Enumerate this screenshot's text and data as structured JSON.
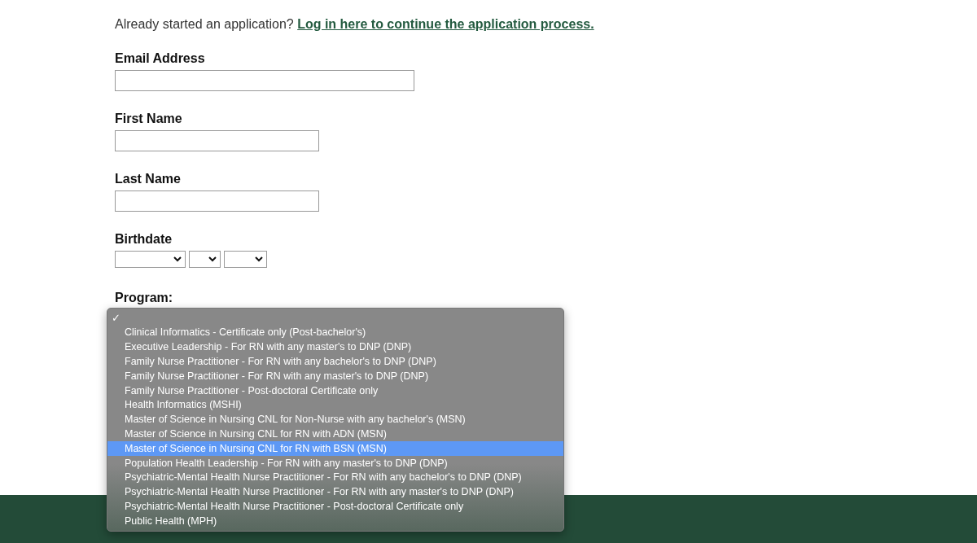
{
  "intro": {
    "text": "Already started an application?",
    "link": "Log in here to continue the application process."
  },
  "fields": [
    {
      "kind": "email",
      "label": "Email Address"
    },
    {
      "kind": "text",
      "label": "First Name"
    },
    {
      "kind": "text",
      "label": "Last Name"
    },
    {
      "kind": "date",
      "label": "Birthdate"
    }
  ],
  "program": {
    "label": "Program:",
    "check_mark": "✓",
    "options": [
      {
        "checked": true,
        "highlighted": false
      },
      {
        "label": "Clinical Informatics - Certificate only (Post-bachelor's)",
        "checked": false,
        "highlighted": false
      },
      {
        "label": "Executive Leadership - For RN with any master's to DNP (DNP)",
        "checked": false,
        "highlighted": false
      },
      {
        "label": "Family Nurse Practitioner - For RN with any bachelor's to DNP (DNP)",
        "checked": false,
        "highlighted": false
      },
      {
        "label": "Family Nurse Practitioner - For RN with any master's to DNP (DNP)",
        "checked": false,
        "highlighted": false
      },
      {
        "label": "Family Nurse Practitioner - Post-doctoral Certificate only",
        "checked": false,
        "highlighted": false
      },
      {
        "label": "Health Informatics (MSHI)",
        "checked": false,
        "highlighted": false
      },
      {
        "label": "Master of Science in Nursing CNL for Non-Nurse with any bachelor's (MSN)",
        "checked": false,
        "highlighted": false
      },
      {
        "label": "Master of Science in Nursing CNL for RN with ADN (MSN)",
        "checked": false,
        "highlighted": false
      },
      {
        "label": "Master of Science in Nursing CNL for RN with BSN (MSN)",
        "checked": false,
        "highlighted": true
      },
      {
        "label": "Population Health Leadership - For RN with any master's to DNP (DNP)",
        "checked": false,
        "highlighted": false
      },
      {
        "label": "Psychiatric-Mental Health Nurse Practitioner - For RN with any bachelor's to DNP (DNP)",
        "checked": false,
        "highlighted": false
      },
      {
        "label": "Psychiatric-Mental Health Nurse Practitioner - For RN with any master's to DNP (DNP)",
        "checked": false,
        "highlighted": false
      },
      {
        "label": "Psychiatric-Mental Health Nurse Practitioner - Post-doctoral Certificate only",
        "checked": false,
        "highlighted": false
      },
      {
        "label": "Public Health (MPH)",
        "checked": false,
        "highlighted": false
      }
    ]
  }
}
